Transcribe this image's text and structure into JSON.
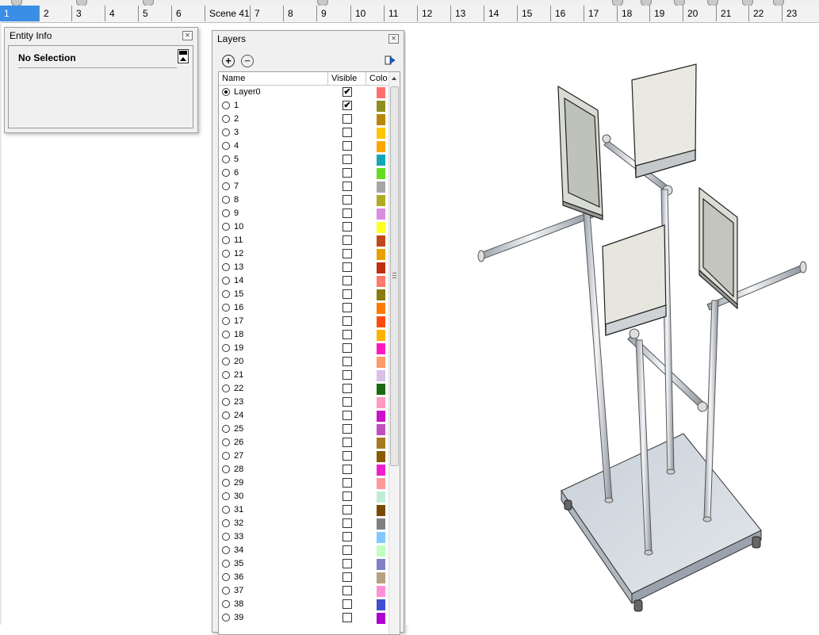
{
  "scenes": {
    "tabs": [
      "1",
      "2",
      "3",
      "4",
      "5",
      "6",
      "Scene 41",
      "7",
      "8",
      "9",
      "10",
      "11",
      "12",
      "13",
      "14",
      "15",
      "16",
      "17",
      "18",
      "19",
      "20",
      "21",
      "22",
      "23"
    ],
    "active_index": 0
  },
  "entity_info": {
    "title": "Entity Info",
    "selection_text": "No Selection",
    "close_icon": "close-icon"
  },
  "layers": {
    "title": "Layers",
    "columns": {
      "name": "Name",
      "visible": "Visible",
      "color": "Colo"
    },
    "add_icon": "plus-circle-icon",
    "remove_icon": "minus-circle-icon",
    "details_icon": "details-arrow-icon",
    "rows": [
      {
        "name": "Layer0",
        "current": true,
        "visible": true,
        "color": "#ff6f6f"
      },
      {
        "name": "1",
        "current": false,
        "visible": true,
        "color": "#8f8f1f"
      },
      {
        "name": "2",
        "current": false,
        "visible": false,
        "color": "#b8860b"
      },
      {
        "name": "3",
        "current": false,
        "visible": false,
        "color": "#ffc400"
      },
      {
        "name": "4",
        "current": false,
        "visible": false,
        "color": "#ffa500"
      },
      {
        "name": "5",
        "current": false,
        "visible": false,
        "color": "#17a6b8"
      },
      {
        "name": "6",
        "current": false,
        "visible": false,
        "color": "#66dd22"
      },
      {
        "name": "7",
        "current": false,
        "visible": false,
        "color": "#a6a6a6"
      },
      {
        "name": "8",
        "current": false,
        "visible": false,
        "color": "#b0aa22"
      },
      {
        "name": "9",
        "current": false,
        "visible": false,
        "color": "#d98ce0"
      },
      {
        "name": "10",
        "current": false,
        "visible": false,
        "color": "#ffff22"
      },
      {
        "name": "11",
        "current": false,
        "visible": false,
        "color": "#c0481a"
      },
      {
        "name": "12",
        "current": false,
        "visible": false,
        "color": "#e8a000"
      },
      {
        "name": "13",
        "current": false,
        "visible": false,
        "color": "#c03010"
      },
      {
        "name": "14",
        "current": false,
        "visible": false,
        "color": "#ff7a6a"
      },
      {
        "name": "15",
        "current": false,
        "visible": false,
        "color": "#8a7a10"
      },
      {
        "name": "16",
        "current": false,
        "visible": false,
        "color": "#ff7a00"
      },
      {
        "name": "17",
        "current": false,
        "visible": false,
        "color": "#ff4a10"
      },
      {
        "name": "18",
        "current": false,
        "visible": false,
        "color": "#ffb300"
      },
      {
        "name": "19",
        "current": false,
        "visible": false,
        "color": "#ff1ac0"
      },
      {
        "name": "20",
        "current": false,
        "visible": false,
        "color": "#ff9a6a"
      },
      {
        "name": "21",
        "current": false,
        "visible": false,
        "color": "#d8c0e8"
      },
      {
        "name": "22",
        "current": false,
        "visible": false,
        "color": "#1a6a10"
      },
      {
        "name": "23",
        "current": false,
        "visible": false,
        "color": "#ff9ac0"
      },
      {
        "name": "24",
        "current": false,
        "visible": false,
        "color": "#cc10cc"
      },
      {
        "name": "25",
        "current": false,
        "visible": false,
        "color": "#c050c0"
      },
      {
        "name": "26",
        "current": false,
        "visible": false,
        "color": "#a87a20"
      },
      {
        "name": "27",
        "current": false,
        "visible": false,
        "color": "#8a5a00"
      },
      {
        "name": "28",
        "current": false,
        "visible": false,
        "color": "#ee20cc"
      },
      {
        "name": "29",
        "current": false,
        "visible": false,
        "color": "#ff9a9a"
      },
      {
        "name": "30",
        "current": false,
        "visible": false,
        "color": "#bfeed8"
      },
      {
        "name": "31",
        "current": false,
        "visible": false,
        "color": "#7a4a00"
      },
      {
        "name": "32",
        "current": false,
        "visible": false,
        "color": "#808080"
      },
      {
        "name": "33",
        "current": false,
        "visible": false,
        "color": "#80c8ff"
      },
      {
        "name": "34",
        "current": false,
        "visible": false,
        "color": "#c0ffc0"
      },
      {
        "name": "35",
        "current": false,
        "visible": false,
        "color": "#8080c8"
      },
      {
        "name": "36",
        "current": false,
        "visible": false,
        "color": "#b8a080"
      },
      {
        "name": "37",
        "current": false,
        "visible": false,
        "color": "#ff90d8"
      },
      {
        "name": "38",
        "current": false,
        "visible": false,
        "color": "#4050d0"
      },
      {
        "name": "39",
        "current": false,
        "visible": false,
        "color": "#b000d0"
      }
    ]
  }
}
